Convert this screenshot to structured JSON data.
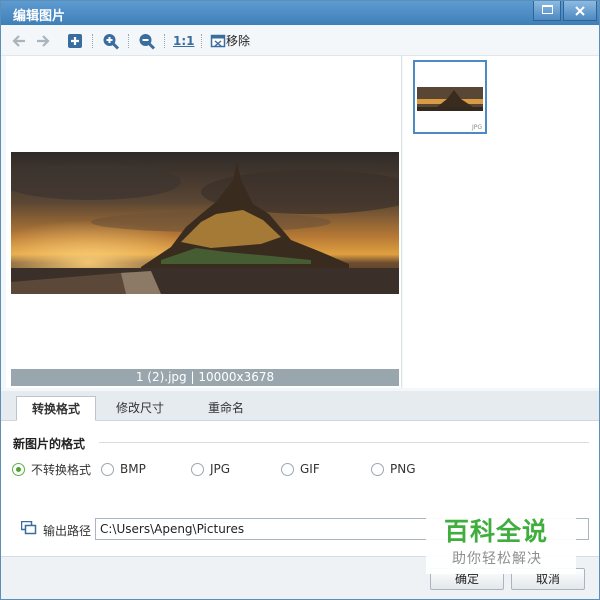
{
  "window": {
    "title": "编辑图片"
  },
  "toolbar": {
    "remove_label": "移除",
    "actual_size_label": "1:1",
    "icons": [
      "back-arrow-icon",
      "forward-arrow-icon",
      "add-icon",
      "zoom-in-icon",
      "zoom-out-icon",
      "actual-size-icon",
      "remove-icon"
    ]
  },
  "preview": {
    "caption": "1 (2).jpg | 10000x3678"
  },
  "thumbnails": [
    {
      "tag": "JPG"
    }
  ],
  "tabs": [
    {
      "label": "转换格式",
      "active": true
    },
    {
      "label": "修改尺寸",
      "active": false
    },
    {
      "label": "重命名",
      "active": false
    }
  ],
  "format": {
    "section_title": "新图片的格式",
    "options": [
      {
        "label": "不转换格式",
        "checked": true
      },
      {
        "label": "BMP",
        "checked": false
      },
      {
        "label": "JPG",
        "checked": false
      },
      {
        "label": "GIF",
        "checked": false
      },
      {
        "label": "PNG",
        "checked": false
      }
    ]
  },
  "output": {
    "label": "输出路径",
    "path": "C:\\Users\\Apeng\\Pictures"
  },
  "footer": {
    "ok_label": "确定",
    "cancel_label": "取消"
  },
  "watermark": {
    "title": "百科全说",
    "subtitle": "助你轻松解决"
  },
  "colors": {
    "title_bar": "#4a8cc6",
    "accent": "#3a6d9f",
    "radio_checked": "#4fa334",
    "watermark_green": "#3fae3d"
  }
}
